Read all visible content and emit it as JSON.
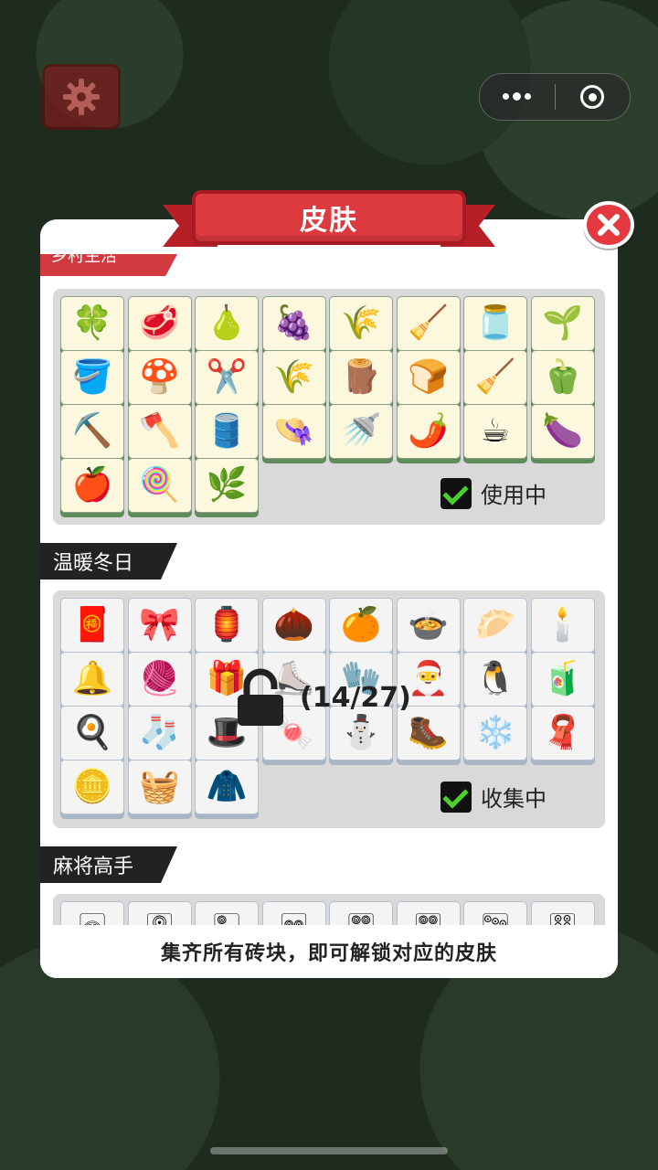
{
  "title": "皮肤",
  "sections": [
    {
      "name": "乡村生活",
      "status": "使用中",
      "tiles": [
        "🍀",
        "🥩",
        "🍐",
        "🍇",
        "🌾",
        "🧹",
        "🫙",
        "🌱",
        "🪣",
        "🍄",
        "✂️",
        "🌾",
        "🪵",
        "🍞",
        "🧹",
        "🫑",
        "⛏️",
        "🪓",
        "🛢️",
        "👒",
        "🚿",
        "🌶️",
        "☕",
        "🍆",
        "🍎",
        "🍭",
        "🌿"
      ]
    },
    {
      "name": "温暖冬日",
      "status": "收集中",
      "progress": "(14/27)",
      "collected": 14,
      "total": 27,
      "tiles": [
        "🧧",
        "🎀",
        "🏮",
        "🌰",
        "🍊",
        "🍲",
        "🥟",
        "🕯️",
        "🔔",
        "🧶",
        "🎁",
        "⛸️",
        "🧤",
        "🎅",
        "🐧",
        "🧃",
        "🍳",
        "🧦",
        "🎩",
        "🍬",
        "⛄",
        "🥾",
        "❄️",
        "🧣",
        "🪙",
        "🧺",
        "🧥"
      ]
    },
    {
      "name": "麻将高手",
      "tiles": [
        "🀙",
        "🀚",
        "🀛",
        "🀜",
        "🀝",
        "🀞",
        "🀟",
        "🀠"
      ]
    }
  ],
  "footer": "集齐所有砖块，即可解锁对应的皮肤",
  "icons": {
    "settings": "gear-icon",
    "more": "more-dots-icon",
    "close_miniapp": "target-icon",
    "close_modal": "close-icon",
    "lock": "padlock-icon",
    "check": "checkbox-checked-icon"
  },
  "colors": {
    "accent_red": "#dd3a3f",
    "check_green": "#4ccf2c",
    "tile_green_base": "#5f8c5a"
  }
}
